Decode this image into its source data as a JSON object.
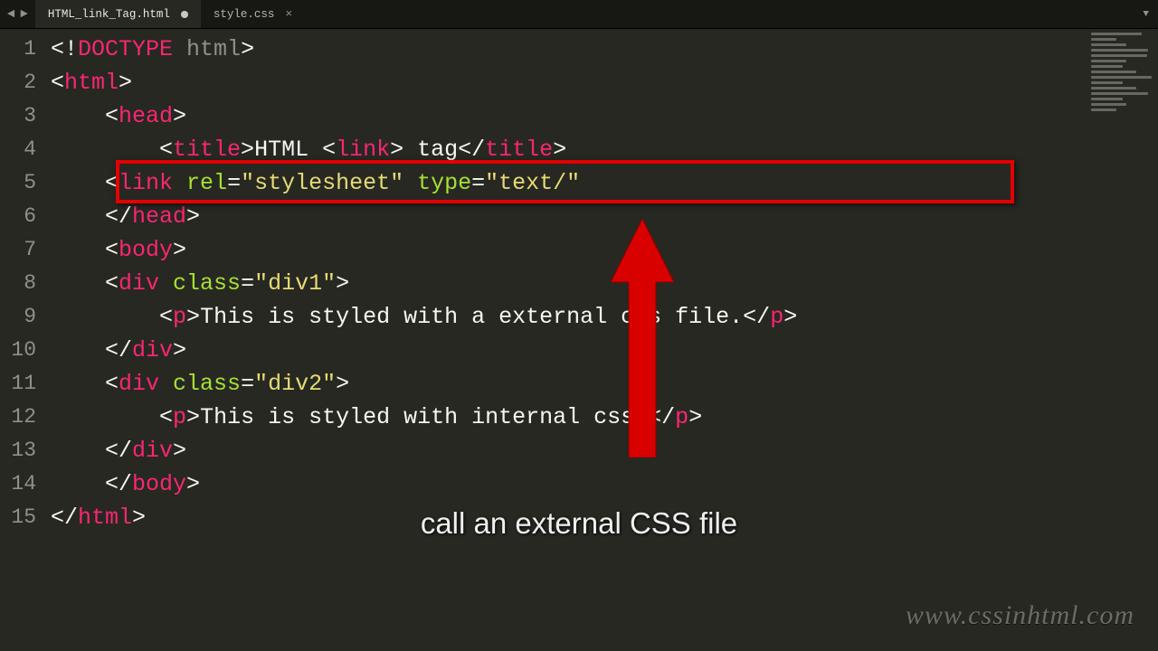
{
  "topbar": {
    "arrows_left": "◄",
    "arrows_right": "►"
  },
  "tabs": [
    {
      "label": "HTML_link_Tag.html",
      "active": true,
      "dirty": true
    },
    {
      "label": "style.css",
      "active": false,
      "dirty": false,
      "close": "×"
    }
  ],
  "gutter_count": 15,
  "lines": {
    "l1_a": "<!",
    "l1_b": "DOCTYPE",
    "l1_c": " html",
    "l1_d": ">",
    "l2_a": "<",
    "l2_b": "html",
    "l2_c": ">",
    "l3_a": "    <",
    "l3_b": "head",
    "l3_c": ">",
    "l4_a": "        <",
    "l4_b": "title",
    "l4_c": ">",
    "l4_d": "HTML <",
    "l4_e": "link",
    "l4_f": "> tag",
    "l4_g": "</",
    "l4_h": "title",
    "l4_i": ">",
    "l5_a": "    <",
    "l5_b": "link",
    "l5_c": " ",
    "l5_d": "rel",
    "l5_e": "=",
    "l5_f": "\"stylesheet\"",
    "l5_g": " ",
    "l5_h": "type",
    "l5_i": "=",
    "l5_j": "\"text/\"",
    "l6_a": "    </",
    "l6_b": "head",
    "l6_c": ">",
    "l7_a": "    <",
    "l7_b": "body",
    "l7_c": ">",
    "l8_a": "    <",
    "l8_b": "div",
    "l8_c": " ",
    "l8_d": "class",
    "l8_e": "=",
    "l8_f": "\"div1\"",
    "l8_g": ">",
    "l9_a": "        <",
    "l9_b": "p",
    "l9_c": ">",
    "l9_d": "This is styled with a external css file.",
    "l9_e": "</",
    "l9_f": "p",
    "l9_g": ">",
    "l10_a": "    </",
    "l10_b": "div",
    "l10_c": ">",
    "l11_a": "    <",
    "l11_b": "div",
    "l11_c": " ",
    "l11_d": "class",
    "l11_e": "=",
    "l11_f": "\"div2\"",
    "l11_g": ">",
    "l12_a": "        <",
    "l12_b": "p",
    "l12_c": ">",
    "l12_d": "This is styled with internal css.",
    "l12_e": "</",
    "l12_f": "p",
    "l12_g": ">",
    "l13_a": "    </",
    "l13_b": "div",
    "l13_c": ">",
    "l14_a": "    </",
    "l14_b": "body",
    "l14_c": ">",
    "l15_a": "</",
    "l15_b": "html",
    "l15_c": ">"
  },
  "caption": "call an external CSS file",
  "watermark": "www.cssinhtml.com"
}
